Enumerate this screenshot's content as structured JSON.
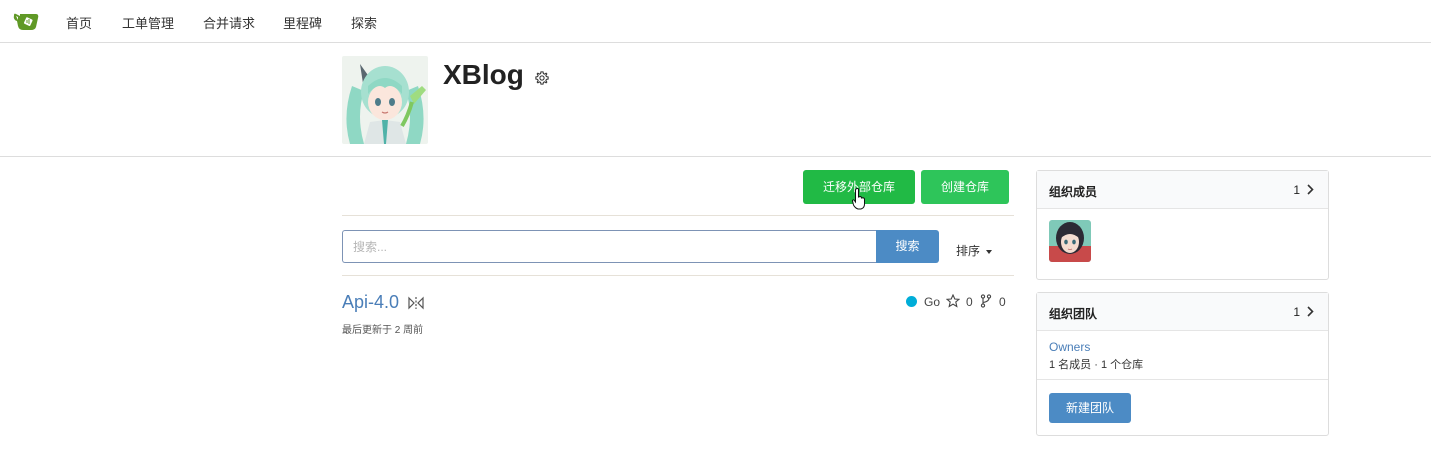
{
  "nav": {
    "items": [
      {
        "label": "首页"
      },
      {
        "label": "工单管理"
      },
      {
        "label": "合并请求"
      },
      {
        "label": "里程碑"
      },
      {
        "label": "探索"
      }
    ],
    "logo_icon": "gitea-teacup-icon",
    "brand_color": "#609926"
  },
  "org": {
    "name": "XBlog",
    "settings_icon": "gear-icon"
  },
  "actions": {
    "migrate_label": "迁移外部仓库",
    "create_label": "创建仓库",
    "green": "#21ba45"
  },
  "search": {
    "placeholder": "搜索...",
    "button_label": "搜索",
    "sort_label": "排序",
    "accent": "#4c8bc5"
  },
  "repos": [
    {
      "name": "Api-4.0",
      "mirror_icon": "mirror-icon",
      "updated": "最后更新于 2 周前",
      "language": "Go",
      "language_color": "#00add8",
      "stars": "0",
      "forks": "0"
    }
  ],
  "sidebar": {
    "members": {
      "title": "组织成员",
      "count": "1"
    },
    "teams": {
      "title": "组织团队",
      "count": "1",
      "team_name": "Owners",
      "team_meta": "1 名成员 · 1 个仓库",
      "new_team_label": "新建团队"
    }
  }
}
